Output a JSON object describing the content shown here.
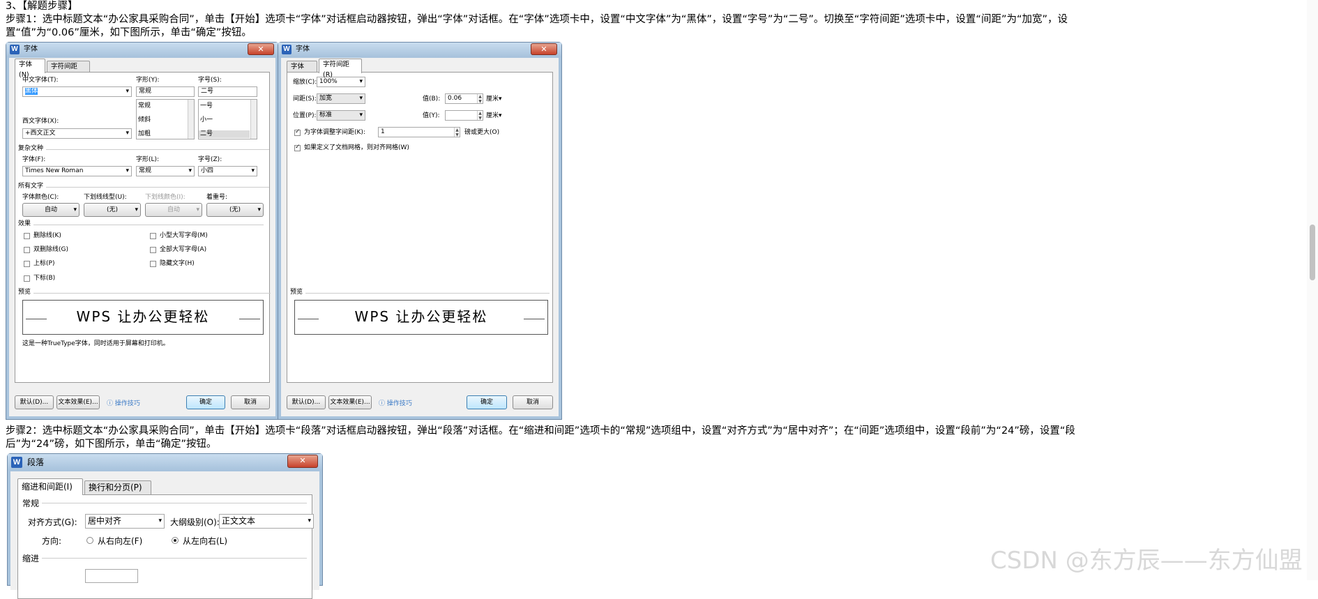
{
  "text": {
    "heading": "3、【解题步骤】",
    "step1a": "步骤1：选中标题文本“办公家具采购合同”，单击【开始】选项卡“字体”对话框启动器按钮，弹出“字体”对话框。在“字体”选项卡中，设置“中文字体”为“黑体”，设置“字号”为“二号”。切换至“字符间距”选项卡中，设置“间距”为“加宽”，设",
    "step1b": "置“值”为“0.06”厘米，如下图所示，单击“确定”按钮。",
    "step2a": "步骤2：选中标题文本“办公家具采购合同”，单击【开始】选项卡“段落”对话框启动器按钮，弹出“段落”对话框。在“缩进和间距”选项卡的“常规”选项组中，设置“对齐方式”为“居中对齐”；在“间距”选项组中，设置“段前”为“24”磅，设置“段",
    "step2b": "后”为“24”磅，如下图所示，单击“确定”按钮。"
  },
  "font_dialog": {
    "title": "字体",
    "tab1": "字体(N)",
    "tab2": "字符间距(R)",
    "cn_font_label": "中文字体(T):",
    "cn_font_value": "黑体",
    "style_label": "字形(Y):",
    "style_value": "常规",
    "size_label": "字号(S):",
    "size_value": "二号",
    "style_list": [
      "常规",
      "倾斜",
      "加粗"
    ],
    "size_list": [
      "一号",
      "小一",
      "二号"
    ],
    "west_font_label": "西文字体(X):",
    "west_font_value": "+西文正文",
    "complex_group": "复杂文种",
    "cfont_label": "字体(F):",
    "cfont_value": "Times New Roman",
    "cstyle_label": "字形(L):",
    "cstyle_value": "常规",
    "csize_label": "字号(Z):",
    "csize_value": "小四",
    "all_group": "所有文字",
    "color_label": "字体颜色(C):",
    "color_value": "自动",
    "uline_label": "下划线线型(U):",
    "uline_value": "(无)",
    "ucolor_label": "下划线颜色(I):",
    "ucolor_value": "自动",
    "emph_label": "着重号:",
    "emph_value": "(无)",
    "effects_group": "效果",
    "effects_left": [
      "删除线(K)",
      "双删除线(G)",
      "上标(P)",
      "下标(B)"
    ],
    "effects_right": [
      "小型大写字母(M)",
      "全部大写字母(A)",
      "隐藏文字(H)"
    ],
    "preview_group": "预览",
    "preview_text": "WPS 让办公更轻松",
    "note": "这是一种TrueType字体，同时适用于屏幕和打印机。",
    "btn_default": "默认(D)...",
    "btn_effects": "文本效果(E)...",
    "tips": "操作技巧",
    "btn_ok": "确定",
    "btn_cancel": "取消"
  },
  "spacing_dialog": {
    "title": "字体",
    "tab1": "字体(N)",
    "tab2": "字符间距(R)",
    "scale_label": "缩放(C):",
    "scale_value": "100%",
    "spacing_label": "间距(S):",
    "spacing_value": "加宽",
    "value_b_label": "值(B):",
    "value_b": "0.06",
    "unit1": "厘米▾",
    "position_label": "位置(P):",
    "position_value": "标准",
    "value_y_label": "值(Y):",
    "value_y": "",
    "unit2": "厘米▾",
    "kern_label": "为字体调整字间距(K):",
    "kern_value": "1",
    "kern_suffix": "磅或更大(O)",
    "grid_label": "如果定义了文档网格，则对齐网格(W)",
    "preview_group": "预览",
    "preview_text": "WPS 让办公更轻松",
    "btn_default": "默认(D)...",
    "btn_effects": "文本效果(E)...",
    "tips": "操作技巧",
    "btn_ok": "确定",
    "btn_cancel": "取消"
  },
  "para_dialog": {
    "title": "段落",
    "tab1": "缩进和间距(I)",
    "tab2": "换行和分页(P)",
    "general_group": "常规",
    "align_label": "对齐方式(G):",
    "align_value": "居中对齐",
    "outline_label": "大纲级别(O):",
    "outline_value": "正文文本",
    "direction_label": "方向:",
    "rtl_label": "从右向左(F)",
    "ltr_label": "从左向右(L)",
    "indent_group": "缩进"
  },
  "watermark": "CSDN @东方辰——东方仙盟",
  "colors": {
    "accent": "#3b7ac6",
    "window_frame": "#a9c4dd",
    "close": "#c7422b"
  }
}
